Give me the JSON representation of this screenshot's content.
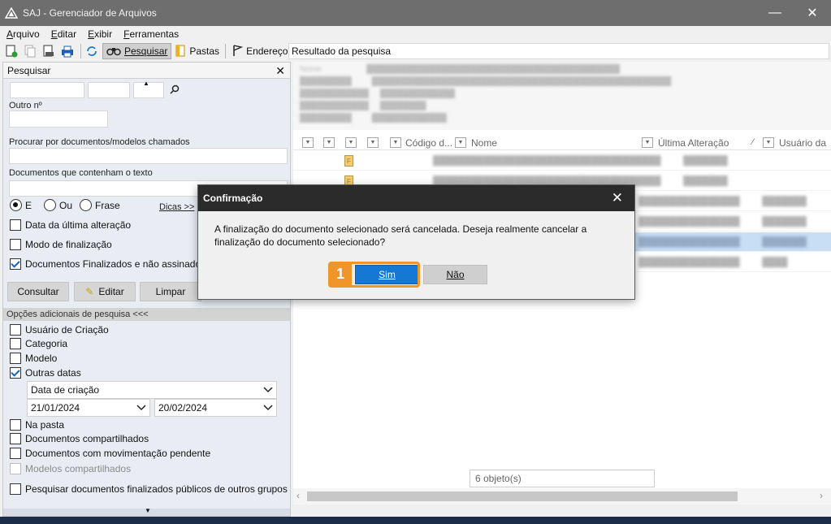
{
  "window": {
    "title": "SAJ - Gerenciador de Arquivos",
    "minimize": "—",
    "close": "✕"
  },
  "menu": [
    "Arquivo",
    "Editar",
    "Exibir",
    "Ferramentas"
  ],
  "toolbar": {
    "search_label": "Pesquisar",
    "folders_label": "Pastas",
    "address_label": "Endereço",
    "address_value": "Resultado da pesquisa"
  },
  "left": {
    "header": "Pesquisar",
    "close": "✕",
    "outro_label": "Outro nº",
    "procurar_label": "Procurar por documentos/modelos chamados",
    "conteudo_label": "Documentos que contenham o texto",
    "radio": {
      "e": "E",
      "ou": "Ou",
      "frase": "Frase"
    },
    "dicas": "Dicas >>",
    "check": {
      "data_alteracao": "Data da última alteração",
      "modo_finalizacao": "Modo de finalização",
      "finalizados": "Documentos Finalizados e não assinados"
    },
    "buttons": {
      "consultar": "Consultar",
      "editar": "Editar",
      "limpar": "Limpar"
    },
    "opcoes_header": "Opções adicionais de pesquisa <<<",
    "opcoes": {
      "usuario": "Usuário de Criação",
      "categoria": "Categoria",
      "modelo": "Modelo",
      "outras_datas": "Outras datas",
      "data_select": "Data de criação",
      "date_from": "21/01/2024",
      "date_to": "20/02/2024",
      "na_pasta": "Na pasta",
      "compartilhados": "Documentos compartilhados",
      "movimentacao": "Documentos com movimentação pendente",
      "modelos_compart": "Modelos compartilhados",
      "publicos": "Pesquisar documentos finalizados públicos de outros grupos"
    }
  },
  "right": {
    "columns": {
      "codigo": "Código d...",
      "nome": "Nome",
      "ultima": "Última Alteração",
      "usuario": "Usuário da"
    },
    "status": "6 objeto(s)"
  },
  "dialog": {
    "title": "Confirmação",
    "close": "✕",
    "message": "A finalização do documento selecionado será cancelada. Deseja realmente cancelar a finalização do documento selecionado?",
    "yes": "Sim",
    "no": "Não",
    "step": "1"
  },
  "colors": {
    "accent": "#1478d4",
    "highlight": "#f0952a",
    "titlebar": "#6e6e6e"
  }
}
